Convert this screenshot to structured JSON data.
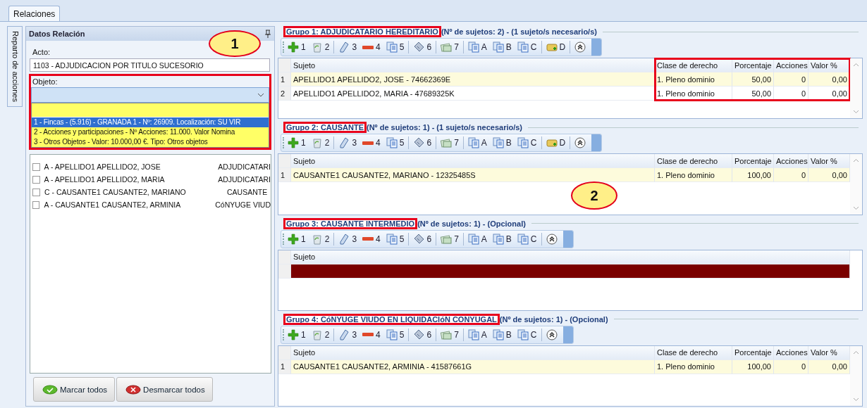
{
  "tab": {
    "label": "Relaciones",
    "selected": true
  },
  "side_tab": {
    "label": "Reparto de acciones",
    "selected": false
  },
  "left_panel": {
    "title": "Datos Relación",
    "acto": {
      "label": "Acto:",
      "value": "1103 - ADJUDICACION POR TITULO SUCESORIO"
    },
    "objeto": {
      "label": "Objeto:",
      "expanded": true,
      "highlighted": true,
      "options": [
        {
          "kind": "blank",
          "selected": false
        },
        {
          "kind": "item",
          "text": "1 - Fincas - (5.916) - GRANADA 1 - Nº: 26909. Localización: SU VIR",
          "selected": true
        },
        {
          "kind": "item",
          "text": "2 - Acciones y participaciones - Nº Acciones: 11.000. Valor Nomina",
          "selected": false
        },
        {
          "kind": "item",
          "text": "3 - Otros Objetos - Valor: 10.000,00 €. Tipo: Otros objetos",
          "selected": false
        }
      ]
    },
    "sujetos": [
      {
        "name": "A - APELLIDO1 APELLIDO2, JOSE",
        "role": "ADJUDICATARI",
        "checked": false
      },
      {
        "name": "A - APELLIDO1 APELLIDO2, MARIA",
        "role": "ADJUDICATARI",
        "checked": false
      },
      {
        "name": "C - CAUSANTE1 CAUSANTE2, MARIANO",
        "role": "CAUSANTE",
        "checked": false
      },
      {
        "name": "A - CAUSANTE1 CAUSANTE2, ARMINIA",
        "role": "CóNYUGE VIUD",
        "checked": false
      }
    ],
    "buttons": [
      {
        "kind": "check",
        "label": "Marcar todos"
      },
      {
        "kind": "uncheck",
        "label": "Desmarcar todos"
      }
    ]
  },
  "groups": [
    {
      "title": "Grupo 1: ADJUDICATARIO HEREDITARIO",
      "subtitle": "(Nº de sujetos: 2) - (1 sujeto/s necesario/s)",
      "title_highlighted": true,
      "columns_highlighted": true,
      "scrollbar": true,
      "toolbar": [
        {
          "kind": "add",
          "label": "1"
        },
        {
          "kind": "bin",
          "label": "2"
        },
        {
          "kind": "separator"
        },
        {
          "kind": "pencil",
          "label": "3"
        },
        {
          "kind": "minus",
          "label": "4"
        },
        {
          "kind": "docs",
          "label": "5"
        },
        {
          "kind": "separator"
        },
        {
          "kind": "calc",
          "label": "6"
        },
        {
          "kind": "separator"
        },
        {
          "kind": "money",
          "label": "7"
        },
        {
          "kind": "separator"
        },
        {
          "kind": "docs",
          "label": "A"
        },
        {
          "kind": "docs",
          "label": "B"
        },
        {
          "kind": "docs",
          "label": "C"
        },
        {
          "kind": "separator"
        },
        {
          "kind": "card",
          "label": "D"
        },
        {
          "kind": "separator"
        },
        {
          "kind": "collapse"
        }
      ],
      "columns": [
        {
          "label": "Sujeto",
          "kind": "text"
        },
        {
          "label": "Clase de derecho",
          "kind": "text"
        },
        {
          "label": "Porcentaje",
          "kind": "number"
        },
        {
          "label": "Acciones",
          "kind": "number"
        },
        {
          "label": "Valor %",
          "kind": "number"
        }
      ],
      "rows": [
        {
          "kind": "data",
          "number": "1",
          "selected": true,
          "cells": [
            "APELLIDO1 APELLIDO2, JOSE - 74662369E",
            "1. Pleno dominio",
            "50,00",
            "0",
            "0,00"
          ]
        },
        {
          "kind": "data",
          "number": "2",
          "selected": false,
          "cells": [
            "APELLIDO1 APELLIDO2, MARIA - 47689325K",
            "1. Pleno dominio",
            "50,00",
            "0",
            "0,00"
          ]
        }
      ]
    },
    {
      "title": "Grupo 2: CAUSANTE",
      "subtitle": "(Nº de sujetos: 1) - (1 sujeto/s necesario/s)",
      "title_highlighted": true,
      "columns_highlighted": false,
      "scrollbar": true,
      "toolbar": [
        {
          "kind": "add",
          "label": "1"
        },
        {
          "kind": "bin",
          "label": "2"
        },
        {
          "kind": "separator"
        },
        {
          "kind": "pencil",
          "label": "3"
        },
        {
          "kind": "minus",
          "label": "4"
        },
        {
          "kind": "docs",
          "label": "5"
        },
        {
          "kind": "separator"
        },
        {
          "kind": "calc",
          "label": "6"
        },
        {
          "kind": "separator"
        },
        {
          "kind": "money",
          "label": "7"
        },
        {
          "kind": "separator"
        },
        {
          "kind": "docs",
          "label": "A"
        },
        {
          "kind": "docs",
          "label": "B"
        },
        {
          "kind": "docs",
          "label": "C"
        },
        {
          "kind": "separator"
        },
        {
          "kind": "card",
          "label": "D"
        },
        {
          "kind": "separator"
        },
        {
          "kind": "collapse"
        }
      ],
      "columns": [
        {
          "label": "Sujeto",
          "kind": "text"
        },
        {
          "label": "Clase de derecho",
          "kind": "text"
        },
        {
          "label": "Porcentaje",
          "kind": "number"
        },
        {
          "label": "Acciones",
          "kind": "number"
        },
        {
          "label": "Valor %",
          "kind": "number"
        }
      ],
      "rows": [
        {
          "kind": "data",
          "number": "1",
          "selected": true,
          "cells": [
            "CAUSANTE1 CAUSANTE2, MARIANO - 12325485S",
            "1. Pleno dominio",
            "100,00",
            "0",
            "0,00"
          ]
        }
      ]
    },
    {
      "title": "Grupo 3: CAUSANTE INTERMEDIO",
      "subtitle": "(Nº de sujetos: 1) - (Opcional)",
      "title_highlighted": true,
      "columns_highlighted": false,
      "scrollbar": false,
      "toolbar": [
        {
          "kind": "add",
          "label": "1"
        },
        {
          "kind": "bin",
          "label": "2"
        },
        {
          "kind": "separator"
        },
        {
          "kind": "pencil",
          "label": "3"
        },
        {
          "kind": "minus",
          "label": "4"
        },
        {
          "kind": "docs",
          "label": "5"
        },
        {
          "kind": "separator"
        },
        {
          "kind": "calc",
          "label": "6"
        },
        {
          "kind": "separator"
        },
        {
          "kind": "money",
          "label": "7"
        },
        {
          "kind": "separator"
        },
        {
          "kind": "docs",
          "label": "A"
        },
        {
          "kind": "docs",
          "label": "B"
        },
        {
          "kind": "docs",
          "label": "C"
        },
        {
          "kind": "separator"
        },
        {
          "kind": "collapse"
        }
      ],
      "columns": [
        {
          "label": "Sujeto",
          "kind": "text"
        }
      ],
      "rows": [
        {
          "kind": "empty",
          "selected": true
        }
      ]
    },
    {
      "title": "Grupo 4: CóNYUGE VIUDO EN LIQUIDACIóN CONYUGAL",
      "subtitle": "(Nº de sujetos: 1) - (Opcional)",
      "title_highlighted": true,
      "columns_highlighted": false,
      "scrollbar": true,
      "toolbar": [
        {
          "kind": "add",
          "label": "1"
        },
        {
          "kind": "bin",
          "label": "2"
        },
        {
          "kind": "separator"
        },
        {
          "kind": "pencil",
          "label": "3"
        },
        {
          "kind": "minus",
          "label": "4"
        },
        {
          "kind": "docs",
          "label": "5"
        },
        {
          "kind": "separator"
        },
        {
          "kind": "calc",
          "label": "6"
        },
        {
          "kind": "separator"
        },
        {
          "kind": "money",
          "label": "7"
        },
        {
          "kind": "separator"
        },
        {
          "kind": "docs",
          "label": "A"
        },
        {
          "kind": "docs",
          "label": "B"
        },
        {
          "kind": "docs",
          "label": "C"
        },
        {
          "kind": "separator"
        },
        {
          "kind": "collapse"
        }
      ],
      "columns": [
        {
          "label": "Sujeto",
          "kind": "text"
        },
        {
          "label": "Clase de derecho",
          "kind": "text"
        },
        {
          "label": "Porcentaje",
          "kind": "number"
        },
        {
          "label": "Acciones",
          "kind": "number"
        },
        {
          "label": "Valor %",
          "kind": "number"
        }
      ],
      "rows": [
        {
          "kind": "data",
          "number": "1",
          "selected": true,
          "cells": [
            "CAUSANTE1 CAUSANTE2, ARMINIA - 41587661G",
            "1. Pleno dominio",
            "100,00",
            "0",
            "0,00"
          ]
        }
      ]
    }
  ],
  "callouts": [
    {
      "text": "1"
    },
    {
      "text": "2"
    }
  ]
}
